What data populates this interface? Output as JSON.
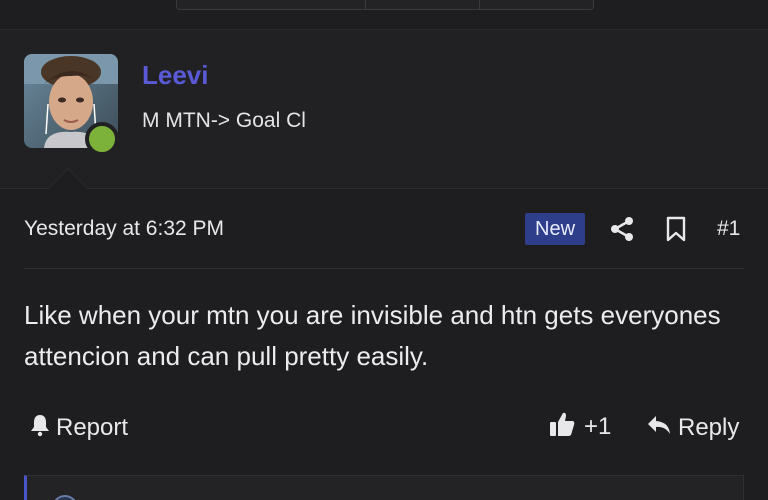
{
  "author": {
    "name": "Leevi",
    "title": "M MTN-> Goal Cl",
    "online": true
  },
  "post": {
    "date": "Yesterday at 6:32 PM",
    "badge": "New",
    "number": "#1",
    "body": "Like when your mtn you are invisible and htn gets everyones attencion and can pull pretty easily."
  },
  "actions": {
    "report_label": "Report",
    "like_count": "+1",
    "reply_label": "Reply"
  },
  "icons": [
    "bell-icon",
    "share-icon",
    "bookmark-icon",
    "thumbs-up-icon",
    "reply-arrow-icon"
  ],
  "colors": {
    "background": "#1e1e20",
    "username": "#5a5ad8",
    "badge_new": "#2f3e8a",
    "online_dot": "#7cb23a"
  }
}
